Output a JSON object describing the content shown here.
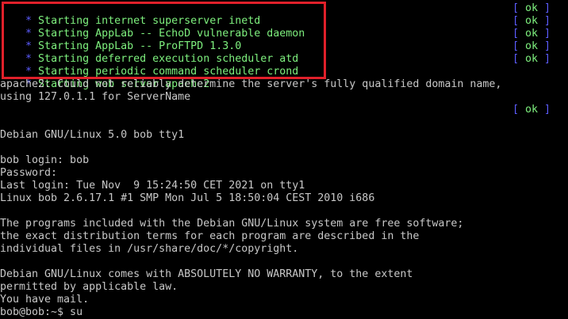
{
  "boot": {
    "lines": [
      {
        "star": "*",
        "text": " Starting internet superserver inetd",
        "open": "[ ",
        "ok": "ok",
        "close": " ]"
      },
      {
        "star": "*",
        "text": " Starting AppLab -- EchoD vulnerable daemon",
        "open": "[ ",
        "ok": "ok",
        "close": " ]"
      },
      {
        "star": "*",
        "text": " Starting AppLab -- ProFTPD 1.3.0",
        "open": "[ ",
        "ok": "ok",
        "close": " ]"
      },
      {
        "star": "*",
        "text": " Starting deferred execution scheduler atd",
        "open": "[ ",
        "ok": "ok",
        "close": " ]"
      },
      {
        "star": "*",
        "text": " Starting periodic command scheduler crond",
        "open": "[ ",
        "ok": "ok",
        "close": " ]"
      },
      {
        "star": "*",
        "text": " Starting web server apache2"
      }
    ],
    "apache_warning_1": "apache2: Could not reliably determine the server's fully qualified domain name,",
    "apache_warning_2": "using 127.0.1.1 for ServerName",
    "apache_status": {
      "open": "[ ",
      "ok": "ok",
      "close": " ]"
    }
  },
  "login": {
    "banner": "Debian GNU/Linux 5.0 bob tty1",
    "login_line": "bob login: bob",
    "password_line": "Password:",
    "last_login": "Last login: Tue Nov  9 15:24:50 CET 2021 on tty1",
    "uname": "Linux bob 2.6.17.1 #1 SMP Mon Jul 5 18:50:04 CEST 2010 i686"
  },
  "motd": {
    "line1": "The programs included with the Debian GNU/Linux system are free software;",
    "line2": "the exact distribution terms for each program are described in the",
    "line3": "individual files in /usr/share/doc/*/copyright.",
    "line4": "Debian GNU/Linux comes with ABSOLUTELY NO WARRANTY, to the extent",
    "line5": "permitted by applicable law.",
    "line6": "You have mail."
  },
  "prompt": {
    "text": "bob@bob:~$ su"
  },
  "colors": {
    "background": "#000000",
    "ok_green": "#7ef07e",
    "star_blue": "#5c5cff",
    "highlight_red": "#e0202a"
  }
}
